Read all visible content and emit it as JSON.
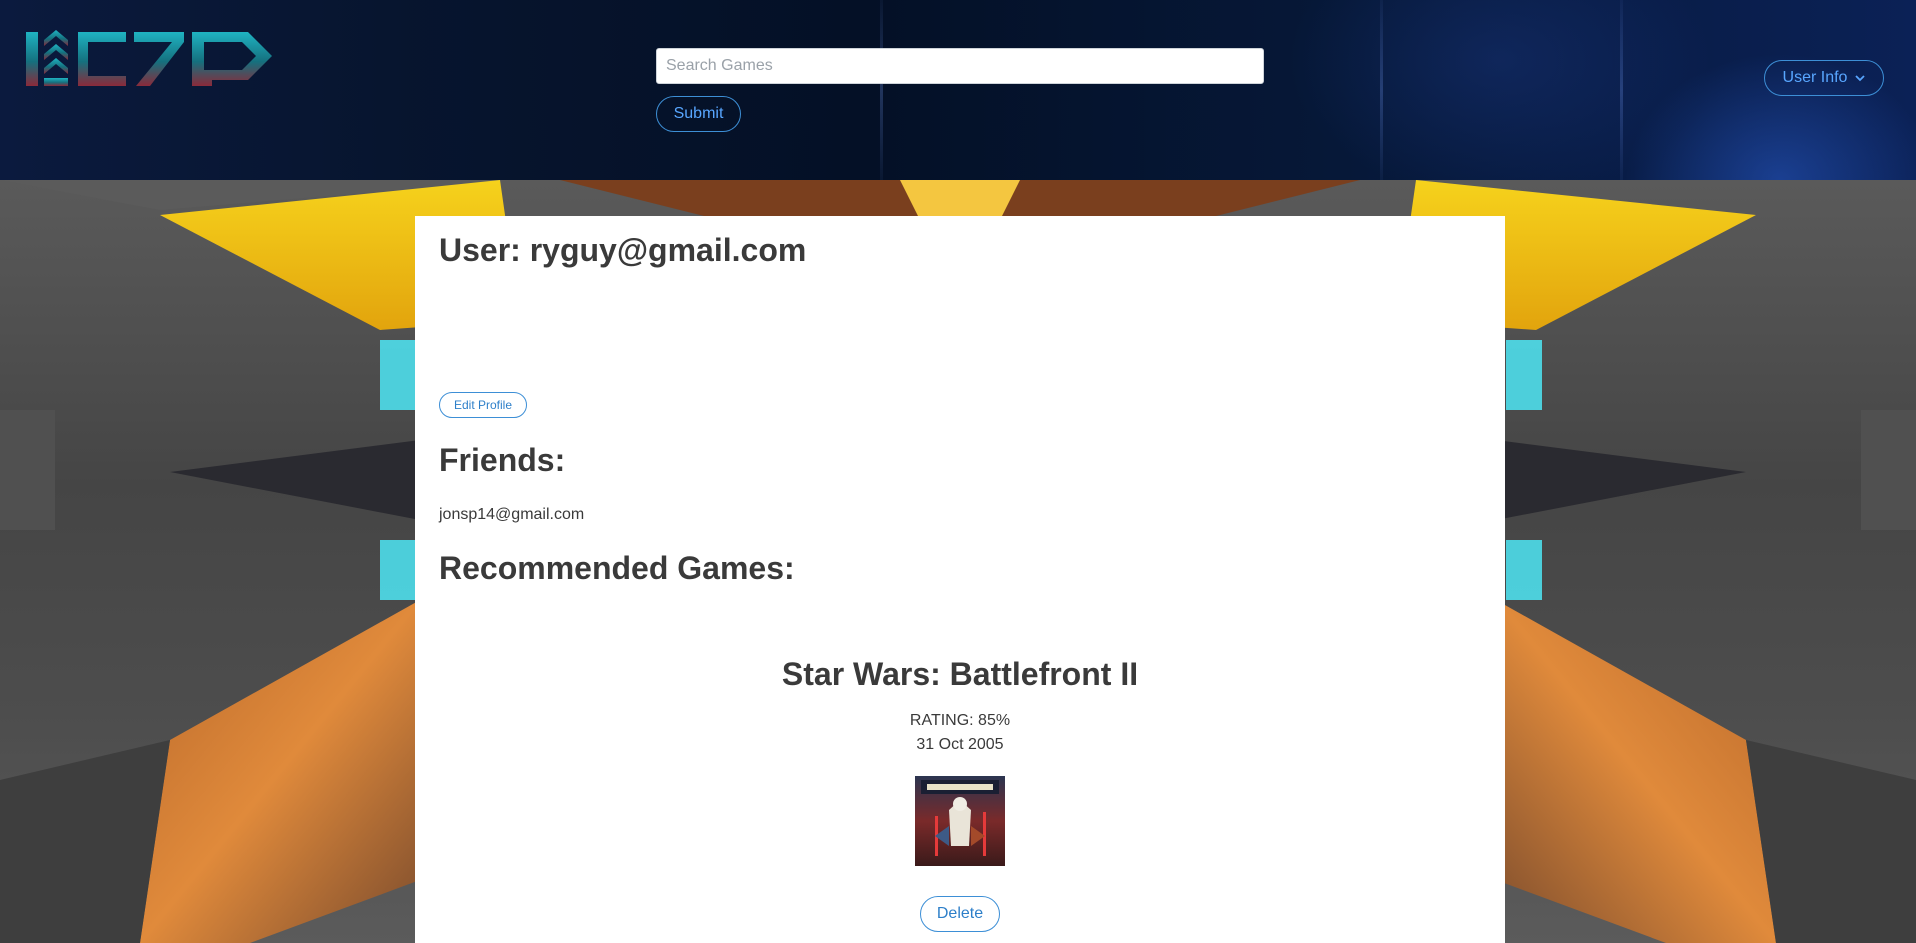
{
  "header": {
    "logo_icon": "site-logo",
    "search": {
      "placeholder": "Search Games",
      "value": ""
    },
    "submit_label": "Submit",
    "user_menu_label": "User Info",
    "user_menu_icon": "chevron-down-icon"
  },
  "profile": {
    "title": "User: ryguy@gmail.com",
    "edit_label": "Edit Profile"
  },
  "friends": {
    "heading": "Friends:",
    "items": [
      "jonsp14@gmail.com"
    ]
  },
  "recommended": {
    "heading": "Recommended Games:",
    "games": [
      {
        "title": "Star Wars: Battlefront II",
        "rating": "RATING: 85%",
        "date": "31 Oct 2005",
        "cover_icon": "game-cover-image",
        "delete_label": "Delete"
      }
    ]
  },
  "colors": {
    "accent": "#3d8fd6",
    "header_bg": "#041026",
    "card_bg": "#ffffff",
    "text": "#3a3a3a"
  }
}
